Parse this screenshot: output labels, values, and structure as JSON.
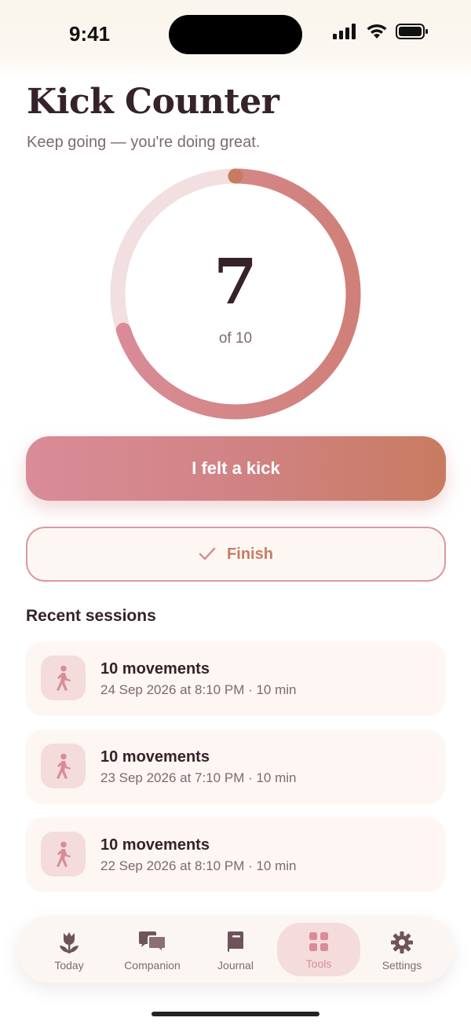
{
  "status_bar": {
    "time": "9:41"
  },
  "header": {
    "title": "Kick Counter",
    "subtitle": "Keep going — you're doing great."
  },
  "counter": {
    "count": "7",
    "of_label": "of 10",
    "progress_fraction": 0.7
  },
  "actions": {
    "kick_label": "I felt a kick",
    "finish_label": "Finish"
  },
  "recent": {
    "title": "Recent sessions",
    "sessions": [
      {
        "title": "10 movements",
        "meta": "24 Sep 2026 at 8:10 PM · 10 min"
      },
      {
        "title": "10 movements",
        "meta": "23 Sep 2026 at 7:10 PM · 10 min"
      },
      {
        "title": "10 movements",
        "meta": "22 Sep 2026 at 8:10 PM · 10 min"
      }
    ]
  },
  "tabs": [
    {
      "label": "Today",
      "icon": "tulip-icon"
    },
    {
      "label": "Companion",
      "icon": "chat-bubbles-icon"
    },
    {
      "label": "Journal",
      "icon": "book-icon"
    },
    {
      "label": "Tools",
      "icon": "grid-icon",
      "active": true
    },
    {
      "label": "Settings",
      "icon": "gear-icon"
    }
  ],
  "colors": {
    "accent": "#d98c98",
    "accent_warm": "#c97b60",
    "ring_track": "#f2dfdf",
    "text_dark": "#35222a",
    "text_muted": "#7d6a6d"
  }
}
